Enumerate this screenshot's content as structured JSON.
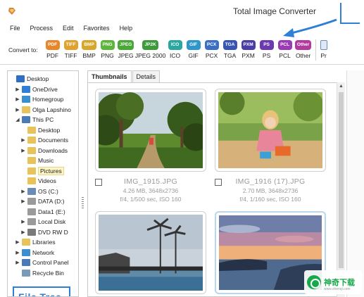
{
  "window": {
    "title": "Total Image Converter"
  },
  "menu": [
    "File",
    "Process",
    "Edit",
    "Favorites",
    "Help"
  ],
  "toolbar": {
    "convert_label": "Convert to:",
    "formats": [
      {
        "badge": "PDF",
        "label": "PDF",
        "color": "#e8872a"
      },
      {
        "badge": "TIFF",
        "label": "TIFF",
        "color": "#e0a22c"
      },
      {
        "badge": "BMP",
        "label": "BMP",
        "color": "#d9a62c"
      },
      {
        "badge": "PNG",
        "label": "PNG",
        "color": "#5db53b"
      },
      {
        "badge": "JPEG",
        "label": "JPEG",
        "color": "#4aa838"
      },
      {
        "badge": "JP2K",
        "label": "JPEG 2000",
        "color": "#3f9a3c"
      },
      {
        "badge": "ICO",
        "label": "ICO",
        "color": "#2aa8a0"
      },
      {
        "badge": "GIF",
        "label": "GIF",
        "color": "#2f96c9"
      },
      {
        "badge": "PCX",
        "label": "PCX",
        "color": "#3b6fc4"
      },
      {
        "badge": "TGA",
        "label": "TGA",
        "color": "#3955b4"
      },
      {
        "badge": "PXM",
        "label": "PXM",
        "color": "#4a3da8"
      },
      {
        "badge": "PS",
        "label": "PS",
        "color": "#6b3ab0"
      },
      {
        "badge": "PCL",
        "label": "PCL",
        "color": "#9a3ab5"
      },
      {
        "badge": "Other",
        "label": "Other",
        "color": "#b13b9f"
      }
    ],
    "extra_label": "Pr"
  },
  "sidebar": {
    "items": [
      {
        "label": "Desktop",
        "arrow": "",
        "icon": "desktop-icon",
        "color": "#2e6fc4"
      },
      {
        "label": "OneDrive",
        "arrow": "▶",
        "icon": "cloud-icon",
        "color": "#2f7fd6"
      },
      {
        "label": "Homegroup",
        "arrow": "▶",
        "icon": "homegroup-icon",
        "color": "#3a8fd0"
      },
      {
        "label": "Olga Lapshino",
        "arrow": "▶",
        "icon": "user-folder-icon",
        "color": "#e8c35a"
      },
      {
        "label": "This PC",
        "arrow": "◢",
        "icon": "computer-icon",
        "color": "#4a7bb8"
      },
      {
        "label": "Desktop",
        "arrow": "",
        "icon": "folder-icon",
        "color": "#e8c35a"
      },
      {
        "label": "Documents",
        "arrow": "▶",
        "icon": "folder-icon",
        "color": "#e8c35a"
      },
      {
        "label": "Downloads",
        "arrow": "▶",
        "icon": "folder-icon",
        "color": "#e8c35a"
      },
      {
        "label": "Music",
        "arrow": "",
        "icon": "folder-icon",
        "color": "#e8c35a"
      },
      {
        "label": "Pictures",
        "arrow": "",
        "icon": "folder-icon",
        "color": "#e8c35a",
        "selected": true
      },
      {
        "label": "Videos",
        "arrow": "",
        "icon": "folder-icon",
        "color": "#e8c35a"
      },
      {
        "label": "OS (C:)",
        "arrow": "▶",
        "icon": "drive-icon",
        "color": "#6a8ab8"
      },
      {
        "label": "DATA (D:)",
        "arrow": "▶",
        "icon": "drive-icon",
        "color": "#9a9a9a"
      },
      {
        "label": "Data1 (E:)",
        "arrow": "",
        "icon": "drive-icon",
        "color": "#9a9a9a"
      },
      {
        "label": "Local Disk",
        "arrow": "▶",
        "icon": "drive-icon",
        "color": "#9a9a9a"
      },
      {
        "label": "DVD RW D",
        "arrow": "▶",
        "icon": "dvd-icon",
        "color": "#7a7a7a"
      },
      {
        "label": "Libraries",
        "arrow": "▶",
        "icon": "library-icon",
        "color": "#e8c35a"
      },
      {
        "label": "Network",
        "arrow": "▶",
        "icon": "network-icon",
        "color": "#3a8fd0"
      },
      {
        "label": "Control Panel",
        "arrow": "▶",
        "icon": "control-panel-icon",
        "color": "#4a7bb8"
      },
      {
        "label": "Recycle Bin",
        "arrow": "",
        "icon": "recycle-bin-icon",
        "color": "#7a9ab8"
      }
    ],
    "annotation": "File Tree"
  },
  "tabs": [
    "Thumbnails",
    "Details"
  ],
  "thumbnails": [
    {
      "name": "IMG_1915.JPG",
      "size": "4.26 MB, 3648x2736",
      "exif": "f/4, 1/500 sec, ISO 160",
      "scene": "park"
    },
    {
      "name": "IMG_1916 (17).JPG",
      "size": "2.70 MB, 3648x2736",
      "exif": "f/4, 1/160 sec, ISO 160",
      "scene": "child"
    },
    {
      "name": "",
      "size": "",
      "exif": "",
      "scene": "palms"
    },
    {
      "name": "",
      "size": "",
      "exif": "",
      "scene": "sunset"
    }
  ],
  "watermark": {
    "text": "神奇下载",
    "sub": "www.shenqi.com"
  }
}
